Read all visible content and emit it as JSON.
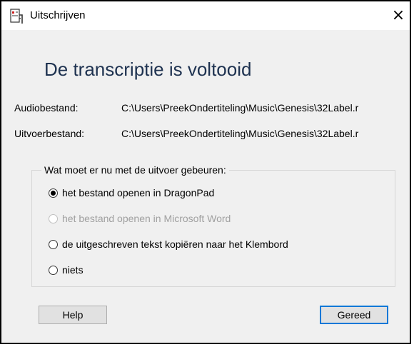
{
  "window": {
    "title": "Uitschrijven",
    "close_glyph": "×"
  },
  "heading": "De transcriptie is voltooid",
  "info": {
    "audio_label": "Audiobestand:",
    "audio_value": "C:\\Users\\PreekOndertiteling\\Music\\Genesis\\32Label.r",
    "output_label": "Uitvoerbestand:",
    "output_value": "C:\\Users\\PreekOndertiteling\\Music\\Genesis\\32Label.r"
  },
  "group": {
    "legend": "Wat moet er nu met de uitvoer gebeuren:",
    "options": [
      {
        "label": "het bestand openen in DragonPad",
        "checked": true,
        "enabled": true
      },
      {
        "label": "het bestand openen in Microsoft Word",
        "checked": false,
        "enabled": false
      },
      {
        "label": "de uitgeschreven tekst kopiëren naar het Klembord",
        "checked": false,
        "enabled": true
      },
      {
        "label": "niets",
        "checked": false,
        "enabled": true
      }
    ]
  },
  "buttons": {
    "help": "Help",
    "done": "Gereed"
  },
  "icons": {
    "app": "document-app-icon",
    "close": "close-icon"
  },
  "colors": {
    "heading": "#1e3250",
    "default_button_border": "#0078d7",
    "disabled_text": "#a0a0a0"
  }
}
